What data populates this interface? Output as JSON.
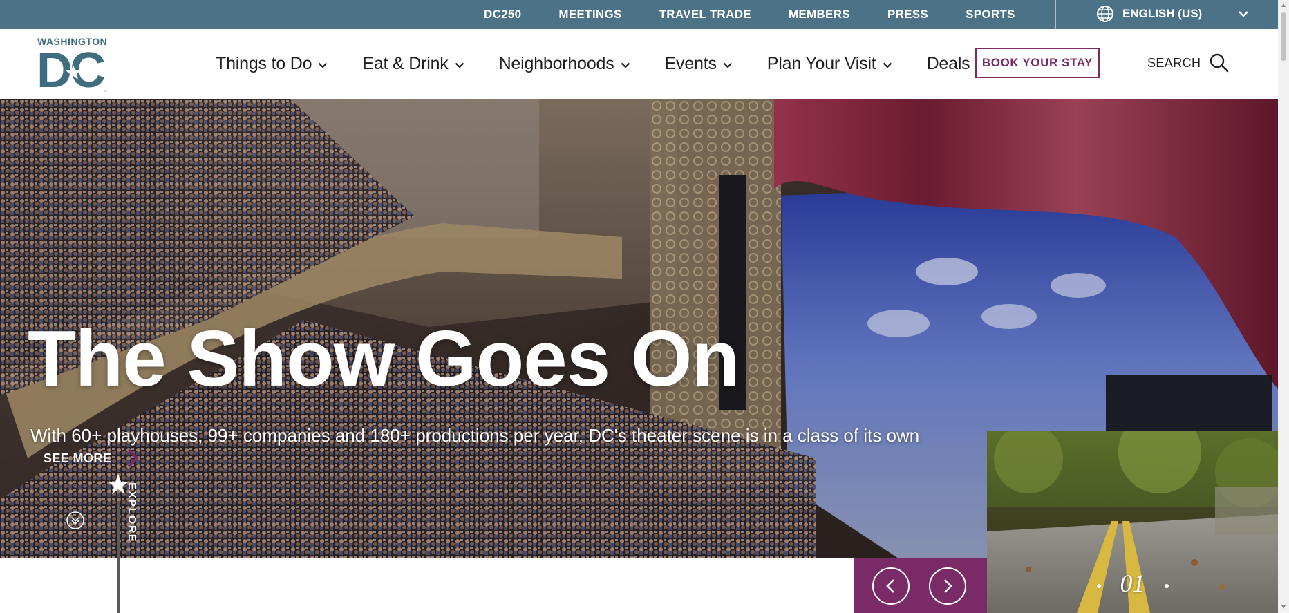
{
  "utility_bar": {
    "links": [
      "DC250",
      "MEETINGS",
      "TRAVEL TRADE",
      "MEMBERS",
      "PRESS",
      "SPORTS"
    ],
    "language": "ENGLISH (US)"
  },
  "logo": {
    "top_text": "WASHINGTON",
    "letters": "DC",
    "tm": "™"
  },
  "nav": {
    "items": [
      {
        "label": "Things to Do",
        "has_dropdown": true
      },
      {
        "label": "Eat & Drink",
        "has_dropdown": true
      },
      {
        "label": "Neighborhoods",
        "has_dropdown": true
      },
      {
        "label": "Events",
        "has_dropdown": true
      },
      {
        "label": "Plan Your Visit",
        "has_dropdown": true
      },
      {
        "label": "Deals",
        "has_dropdown": false
      }
    ],
    "book_label": "BOOK YOUR STAY",
    "search_label": "SEARCH"
  },
  "hero": {
    "title": "The Show Goes On",
    "subtitle": "With 60+ playhouses, 99+ companies and 180+ productions per year, DC's theater scene is in a class of its own",
    "see_more": "SEE MORE",
    "explore": "EXPLORE",
    "slide_counter": "01"
  },
  "colors": {
    "utility_bar": "#4b7286",
    "brand_purple": "#7a2a66",
    "logo_teal": "#3f6d80"
  }
}
